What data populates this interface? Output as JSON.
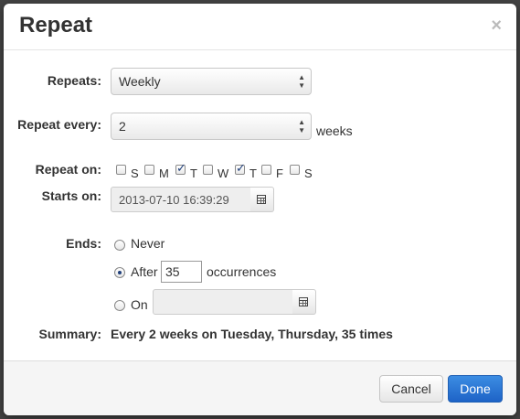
{
  "dialog": {
    "title": "Repeat",
    "close_glyph": "×"
  },
  "repeats": {
    "label": "Repeats:",
    "value": "Weekly"
  },
  "repeat_every": {
    "label": "Repeat every:",
    "value": "2",
    "unit": "weeks"
  },
  "repeat_on": {
    "label": "Repeat on:",
    "days": [
      {
        "letter": "S",
        "checked": false
      },
      {
        "letter": "M",
        "checked": false
      },
      {
        "letter": "T",
        "checked": true
      },
      {
        "letter": "W",
        "checked": false
      },
      {
        "letter": "T",
        "checked": true
      },
      {
        "letter": "F",
        "checked": false
      },
      {
        "letter": "S",
        "checked": false
      }
    ]
  },
  "starts_on": {
    "label": "Starts on:",
    "value": "2013-07-10 16:39:29",
    "icon": "calendar-icon"
  },
  "ends": {
    "label": "Ends:",
    "never_label": "Never",
    "after_label": "After",
    "after_value": "35",
    "after_unit": "occurrences",
    "on_label": "On",
    "on_value": "",
    "selected": "after"
  },
  "summary": {
    "label": "Summary:",
    "value": "Every 2 weeks on Tuesday, Thursday, 35 times"
  },
  "footer": {
    "cancel_label": "Cancel",
    "done_label": "Done"
  },
  "colors": {
    "primary": "#1e63c7",
    "check": "#1f3f7a"
  }
}
